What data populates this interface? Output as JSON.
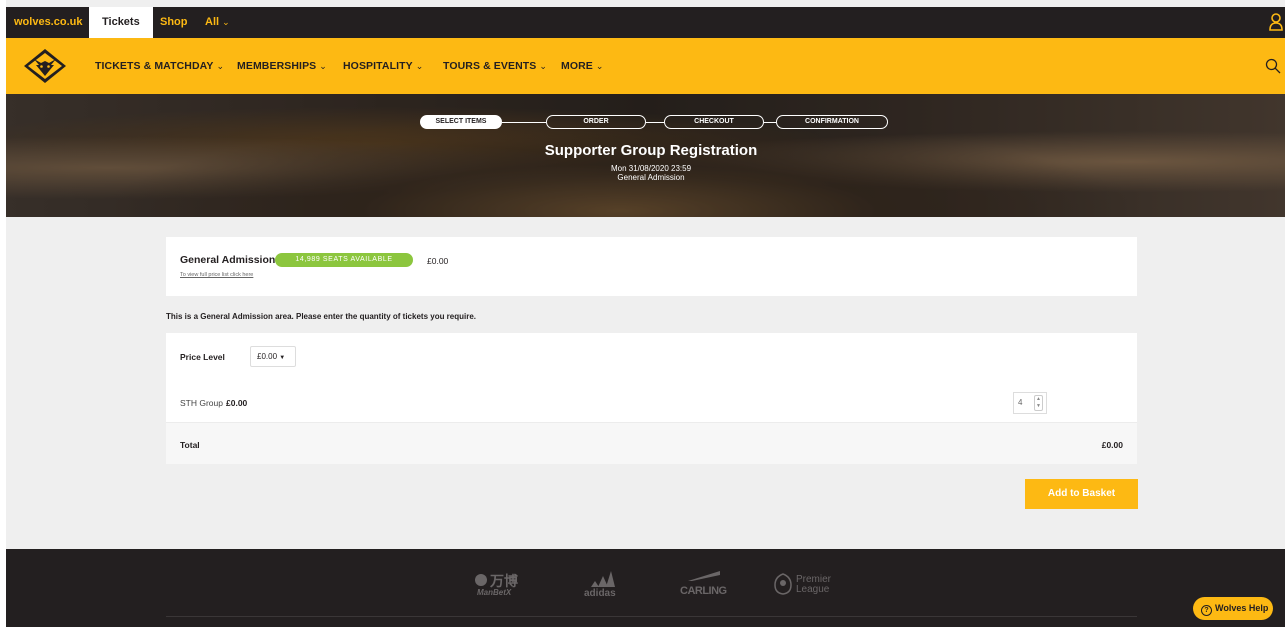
{
  "topbar": {
    "site_link": "wolves.co.uk",
    "tab_tickets": "Tickets",
    "tab_shop": "Shop",
    "tab_all": "All"
  },
  "nav": {
    "items": [
      {
        "label": "TICKETS & MATCHDAY"
      },
      {
        "label": "MEMBERSHIPS"
      },
      {
        "label": "HOSPITALITY"
      },
      {
        "label": "TOURS & EVENTS"
      },
      {
        "label": "MORE"
      }
    ]
  },
  "steps": {
    "select": "SELECT ITEMS",
    "order": "ORDER",
    "checkout": "CHECKOUT",
    "confirmation": "CONFIRMATION"
  },
  "hero": {
    "title": "Supporter Group Registration",
    "date": "Mon 31/08/2020 23:59",
    "area": "General Admission"
  },
  "area_card": {
    "title": "General Admission",
    "seats_badge": "14,989 SEATS AVAILABLE",
    "price": "£0.00",
    "price_list_link": "To view full price list click here"
  },
  "info_text": "This is a General Admission area. Please enter the quantity of tickets you require.",
  "ticket_card": {
    "price_level_label": "Price Level",
    "price_level_value": "£0.00",
    "ticket_type": "STH Group",
    "ticket_price": "£0.00",
    "quantity": "4",
    "total_label": "Total",
    "total_value": "£0.00"
  },
  "add_button": "Add to Basket",
  "footer": {
    "sponsors": {
      "manbetx_cn": "万博",
      "manbetx": "ManBetX",
      "adidas": "adidas",
      "carling": "CARLING",
      "premier": "Premier",
      "league": "League"
    }
  },
  "help_button": "Wolves Help",
  "colors": {
    "brand_gold": "#fdb913",
    "brand_black": "#231f20",
    "seats_green": "#8cc63e"
  }
}
